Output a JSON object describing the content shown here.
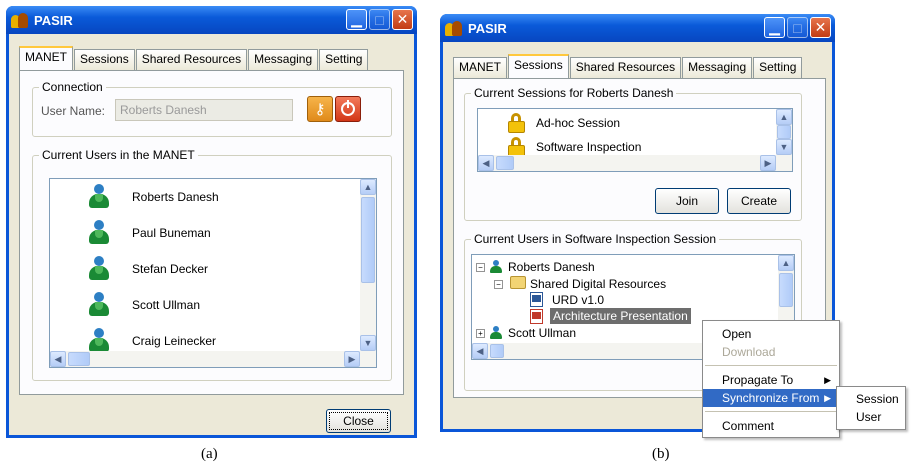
{
  "window_a": {
    "title": "PASIR",
    "tabs": [
      "MANET",
      "Sessions",
      "Shared Resources",
      "Messaging",
      "Setting"
    ],
    "active_tab": "MANET",
    "connection": {
      "group_title": "Connection",
      "user_name_label": "User Name:",
      "user_name_value": "Roberts Danesh"
    },
    "users_group_title": "Current Users in the MANET",
    "users": [
      "Roberts Danesh",
      "Paul Buneman",
      "Stefan Decker",
      "Scott Ullman",
      "Craig Leinecker"
    ],
    "close_label": "Close",
    "caption": "(a)"
  },
  "window_b": {
    "title": "PASIR",
    "tabs": [
      "MANET",
      "Sessions",
      "Shared Resources",
      "Messaging",
      "Setting"
    ],
    "active_tab": "Sessions",
    "sessions_group_title": "Current Sessions for Roberts Danesh",
    "sessions": [
      "Ad-hoc Session",
      "Software Inspection"
    ],
    "join_label": "Join",
    "create_label": "Create",
    "users_group_title": "Current Users in Software Inspection Session",
    "tree": {
      "user1": "Roberts Danesh",
      "folder": "Shared Digital Resources",
      "file1": "URD v1.0",
      "file2": "Architecture Presentation",
      "user2": "Scott Ullman"
    },
    "caption": "(b)"
  },
  "context_menu": {
    "items": [
      "Open",
      "Download",
      "Propagate To",
      "Synchronize From",
      "Comment"
    ],
    "disabled": [
      "Download"
    ],
    "highlighted": "Synchronize From"
  },
  "submenu": {
    "items": [
      "Session",
      "User"
    ]
  },
  "colors": {
    "title_bar": "#0a56d8",
    "client_bg": "#ece9d8",
    "selection": "#316ac5",
    "tab_highlight": "#ffc83c"
  }
}
